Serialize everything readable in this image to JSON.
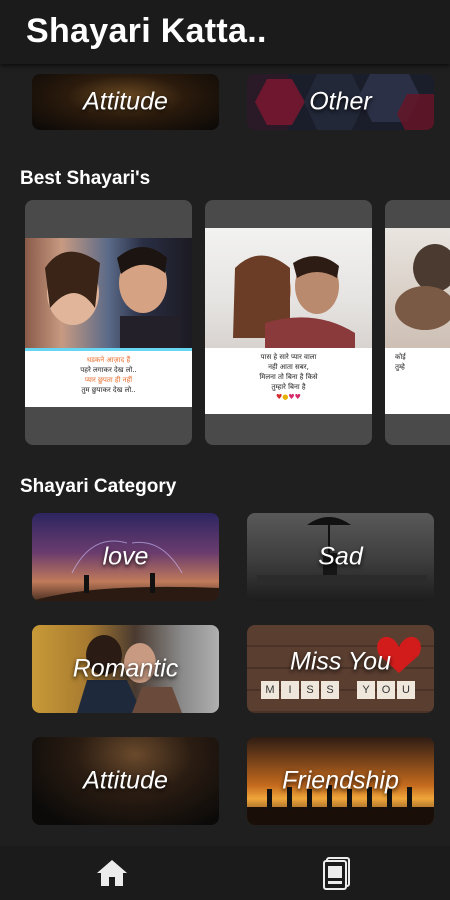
{
  "app": {
    "title": "Shayari Katta.."
  },
  "top_categories": [
    {
      "label": "Attitude"
    },
    {
      "label": "Other"
    }
  ],
  "best_section": {
    "title": "Best Shayari's",
    "cards": [
      {
        "lines": [
          "धडकने आज़ाद हैं",
          "पहरे लगाकर देख लो..",
          "प्यार छुपता ही नहीं",
          "तुम छुपाकर देख लो.."
        ]
      },
      {
        "lines": [
          "पास हे सारे प्यार वाला",
          "नही आता सबर,",
          "मिलना तो बिना है किसे",
          "तुम्हारे बिना है"
        ]
      },
      {
        "lines": [
          "कोई",
          "तुम्हे"
        ]
      }
    ]
  },
  "category_section": {
    "title": "Shayari Category",
    "items": [
      {
        "label": "love"
      },
      {
        "label": "Sad"
      },
      {
        "label": "Romantic"
      },
      {
        "label": "Miss You"
      },
      {
        "label": "Attitude"
      },
      {
        "label": "Friendship"
      }
    ],
    "miss_you_tiles": [
      "M",
      "I",
      "S",
      "S",
      "Y",
      "O",
      "U"
    ]
  },
  "nav": {
    "home_icon": "home-icon",
    "gallery_icon": "photo-gallery-icon"
  }
}
